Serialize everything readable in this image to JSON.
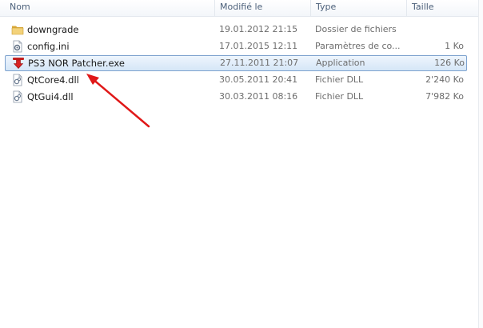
{
  "columns": {
    "name": "Nom",
    "modified": "Modifié le",
    "type": "Type",
    "size": "Taille"
  },
  "sort_indicator": "^",
  "files": [
    {
      "name": "downgrade",
      "modified": "19.01.2012 21:15",
      "type": "Dossier de fichiers",
      "size": "",
      "icon": "folder-icon"
    },
    {
      "name": "config.ini",
      "modified": "17.01.2015 12:11",
      "type": "Paramètres de co...",
      "size": "1 Ko",
      "icon": "settings-file-icon"
    },
    {
      "name": "PS3 NOR Patcher.exe",
      "modified": "27.11.2011 21:07",
      "type": "Application",
      "size": "126 Ko",
      "icon": "application-icon"
    },
    {
      "name": "QtCore4.dll",
      "modified": "30.05.2011 20:41",
      "type": "Fichier DLL",
      "size": "2'240 Ko",
      "icon": "dll-file-icon"
    },
    {
      "name": "QtGui4.dll",
      "modified": "30.03.2011 08:16",
      "type": "Fichier DLL",
      "size": "7'982 Ko",
      "icon": "dll-file-icon"
    }
  ],
  "selected_file": "PS3 NOR Patcher.exe",
  "colors": {
    "selection_border": "#7da2ce",
    "annotation_arrow": "#e01818",
    "folder": "#e8c15a"
  }
}
